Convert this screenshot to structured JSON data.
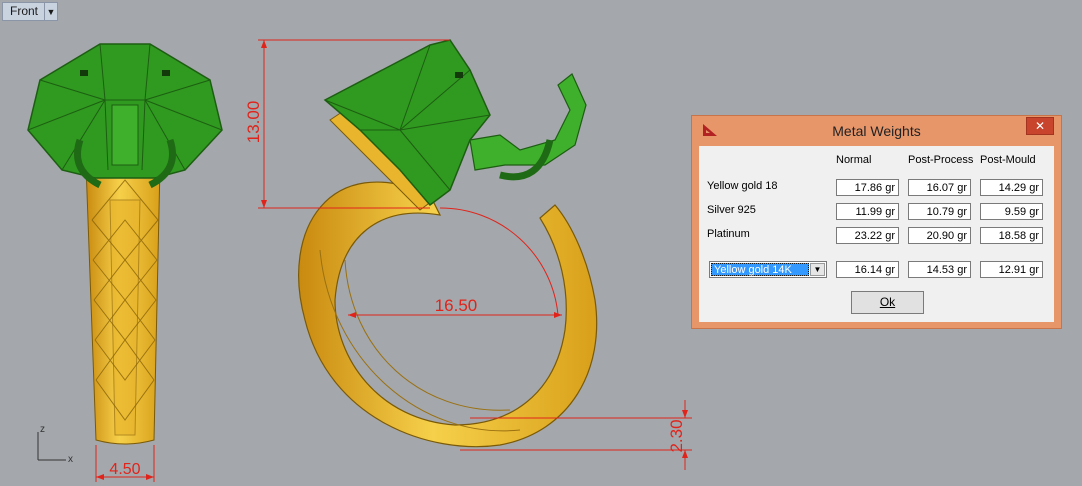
{
  "viewport": {
    "name": "Front",
    "axes": {
      "z": "z",
      "x": "x"
    },
    "dimensions": {
      "height": "13.00",
      "inner_diameter": "16.50",
      "band_width": "4.50",
      "band_thickness": "2.30"
    }
  },
  "colors": {
    "background": "#a4a7ab",
    "dimension": "#e0241b",
    "metal": "#f2c230",
    "stone": "#2e8b1f"
  },
  "dialog": {
    "title": "Metal Weights",
    "close_label": "✕",
    "columns": [
      "Normal",
      "Post-Process",
      "Post-Mould"
    ],
    "rows": [
      {
        "label": "Yellow gold 18",
        "values": [
          "17.86 gr",
          "16.07 gr",
          "14.29 gr"
        ]
      },
      {
        "label": "Silver 925",
        "values": [
          "11.99 gr",
          "10.79 gr",
          "9.59 gr"
        ]
      },
      {
        "label": "Platinum",
        "values": [
          "23.22 gr",
          "20.90 gr",
          "18.58 gr"
        ]
      }
    ],
    "custom": {
      "selected": "Yellow gold 14K",
      "values": [
        "16.14 gr",
        "14.53 gr",
        "12.91 gr"
      ]
    },
    "ok_label": "Ok"
  }
}
